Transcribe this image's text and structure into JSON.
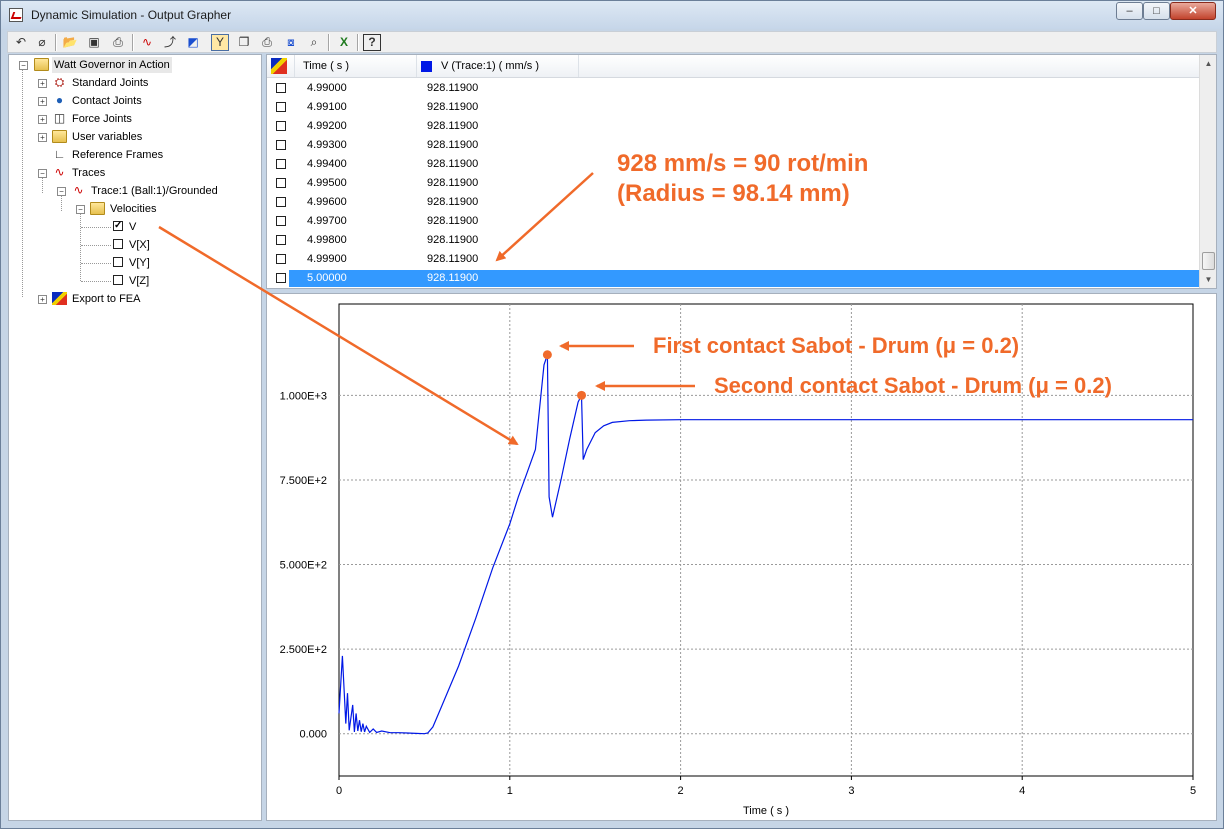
{
  "window": {
    "title": "Dynamic Simulation - Output Grapher",
    "min_glyph": "–",
    "max_glyph": "□",
    "close_glyph": "✕"
  },
  "toolbar": {
    "buttons": [
      {
        "name": "undo-icon",
        "glyph": "↶"
      },
      {
        "name": "eraser-icon",
        "glyph": "⌀"
      },
      {
        "name": "open-folder-icon",
        "glyph": "📂"
      },
      {
        "name": "save-icon",
        "glyph": "▣"
      },
      {
        "name": "save-as-icon",
        "glyph": "⎙"
      },
      {
        "name": "add-trace-icon",
        "glyph": "∿"
      },
      {
        "name": "add-point-icon",
        "glyph": "⤴"
      },
      {
        "name": "fea-export-icon",
        "glyph": "◩"
      },
      {
        "name": "filter-icon",
        "glyph": "Y"
      },
      {
        "name": "copy-icon",
        "glyph": "❐"
      },
      {
        "name": "print-icon",
        "glyph": "⎙"
      },
      {
        "name": "zoom-fit-icon",
        "glyph": "⧇"
      },
      {
        "name": "zoom-icon",
        "glyph": "⌕"
      },
      {
        "name": "excel-icon",
        "glyph": "X"
      },
      {
        "name": "help-icon",
        "glyph": "?"
      }
    ]
  },
  "tree": {
    "root": "Watt Governor in Action",
    "standard_joints": "Standard Joints",
    "contact_joints": "Contact Joints",
    "force_joints": "Force Joints",
    "user_variables": "User variables",
    "reference_frames": "Reference Frames",
    "traces": "Traces",
    "trace1": "Trace:1 (Ball:1)/Grounded",
    "velocities": "Velocities",
    "v": "V",
    "vx": "V[X]",
    "vy": "V[Y]",
    "vz": "V[Z]",
    "export_fea": "Export to FEA",
    "check_mark": "✓"
  },
  "table": {
    "col_time": "Time ( s )",
    "col_series": "V (Trace:1) ( mm/s )",
    "series_color": "#0018e6",
    "rows": [
      {
        "time": "4.99000",
        "v": "928.11900"
      },
      {
        "time": "4.99100",
        "v": "928.11900"
      },
      {
        "time": "4.99200",
        "v": "928.11900"
      },
      {
        "time": "4.99300",
        "v": "928.11900"
      },
      {
        "time": "4.99400",
        "v": "928.11900"
      },
      {
        "time": "4.99500",
        "v": "928.11900"
      },
      {
        "time": "4.99600",
        "v": "928.11900"
      },
      {
        "time": "4.99700",
        "v": "928.11900"
      },
      {
        "time": "4.99800",
        "v": "928.11900"
      },
      {
        "time": "4.99900",
        "v": "928.11900"
      },
      {
        "time": "5.00000",
        "v": "928.11900"
      }
    ],
    "selected_row": 10,
    "scroll_up_glyph": "▲",
    "scroll_down_glyph": "▼"
  },
  "annotations": {
    "speed_line1": "928 mm/s = 90 rot/min",
    "speed_line2": "(Radius = 98.14 mm)",
    "first_contact": "First contact Sabot - Drum (μ = 0.2)",
    "second_contact": "Second contact Sabot - Drum (μ = 0.2)",
    "color": "#f06a2a"
  },
  "chart_data": {
    "type": "line",
    "xlabel": "Time ( s )",
    "ylabel": "",
    "xlim": [
      0,
      5
    ],
    "ylim": [
      -125,
      1270
    ],
    "xticks": [
      0,
      1,
      2,
      3,
      4,
      5
    ],
    "xtick_labels": [
      "0",
      "1",
      "2",
      "3",
      "4",
      "5"
    ],
    "yticks": [
      0,
      250,
      500,
      750,
      1000
    ],
    "ytick_labels": [
      "0.000",
      "2.500E+2",
      "5.000E+2",
      "7.500E+2",
      "1.000E+3"
    ],
    "grid": true,
    "line_color": "#0018e6",
    "series": [
      {
        "name": "V (Trace:1)",
        "x": [
          0,
          0.02,
          0.04,
          0.05,
          0.06,
          0.08,
          0.09,
          0.1,
          0.11,
          0.12,
          0.13,
          0.14,
          0.15,
          0.16,
          0.18,
          0.2,
          0.22,
          0.25,
          0.3,
          0.35,
          0.4,
          0.45,
          0.5,
          0.52,
          0.55,
          0.6,
          0.7,
          0.8,
          0.9,
          1.0,
          1.05,
          1.1,
          1.15,
          1.2,
          1.22,
          1.23,
          1.25,
          1.3,
          1.35,
          1.4,
          1.42,
          1.43,
          1.45,
          1.5,
          1.55,
          1.6,
          1.7,
          1.8,
          2.0,
          2.5,
          3.0,
          3.5,
          4.0,
          4.5,
          5.0
        ],
        "y": [
          60,
          230,
          30,
          120,
          10,
          85,
          5,
          60,
          8,
          40,
          6,
          30,
          5,
          22,
          4,
          14,
          4,
          8,
          3,
          3,
          2,
          1,
          0,
          2,
          20,
          80,
          200,
          340,
          490,
          620,
          700,
          770,
          840,
          1090,
          1120,
          700,
          640,
          750,
          870,
          980,
          1000,
          810,
          840,
          890,
          910,
          920,
          925,
          927,
          928,
          928,
          928,
          928,
          928,
          928,
          928
        ]
      }
    ],
    "markers": [
      {
        "x": 1.22,
        "y": 1120
      },
      {
        "x": 1.42,
        "y": 1000
      }
    ]
  }
}
